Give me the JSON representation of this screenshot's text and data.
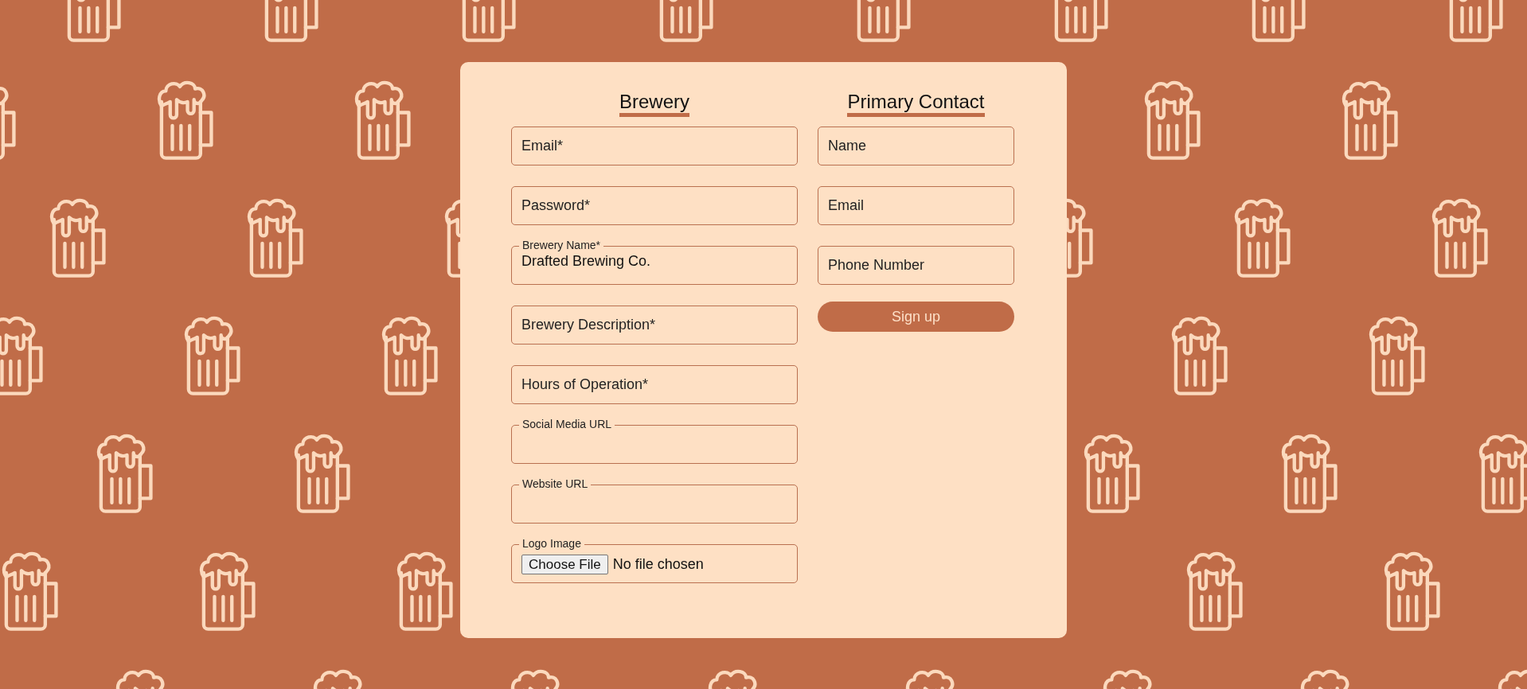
{
  "columns": [
    {
      "heading": "Brewery",
      "fields": [
        {
          "kind": "text",
          "placeholder": "Email*"
        },
        {
          "kind": "text",
          "placeholder": "Password*"
        },
        {
          "kind": "text",
          "label": "Brewery Name*",
          "value": "Drafted Brewing Co."
        },
        {
          "kind": "text",
          "placeholder": "Brewery Description*"
        },
        {
          "kind": "text",
          "placeholder": "Hours of Operation*"
        },
        {
          "kind": "text",
          "label": "Social Media URL"
        },
        {
          "kind": "text",
          "label": "Website URL"
        },
        {
          "kind": "file",
          "label": "Logo Image",
          "button": "Choose File",
          "status": "No file chosen"
        }
      ]
    },
    {
      "heading": "Primary Contact",
      "fields": [
        {
          "kind": "text",
          "placeholder": "Name"
        },
        {
          "kind": "text",
          "placeholder": "Email"
        },
        {
          "kind": "text",
          "placeholder": "Phone Number"
        },
        {
          "kind": "button",
          "label": "Sign up"
        }
      ]
    }
  ]
}
